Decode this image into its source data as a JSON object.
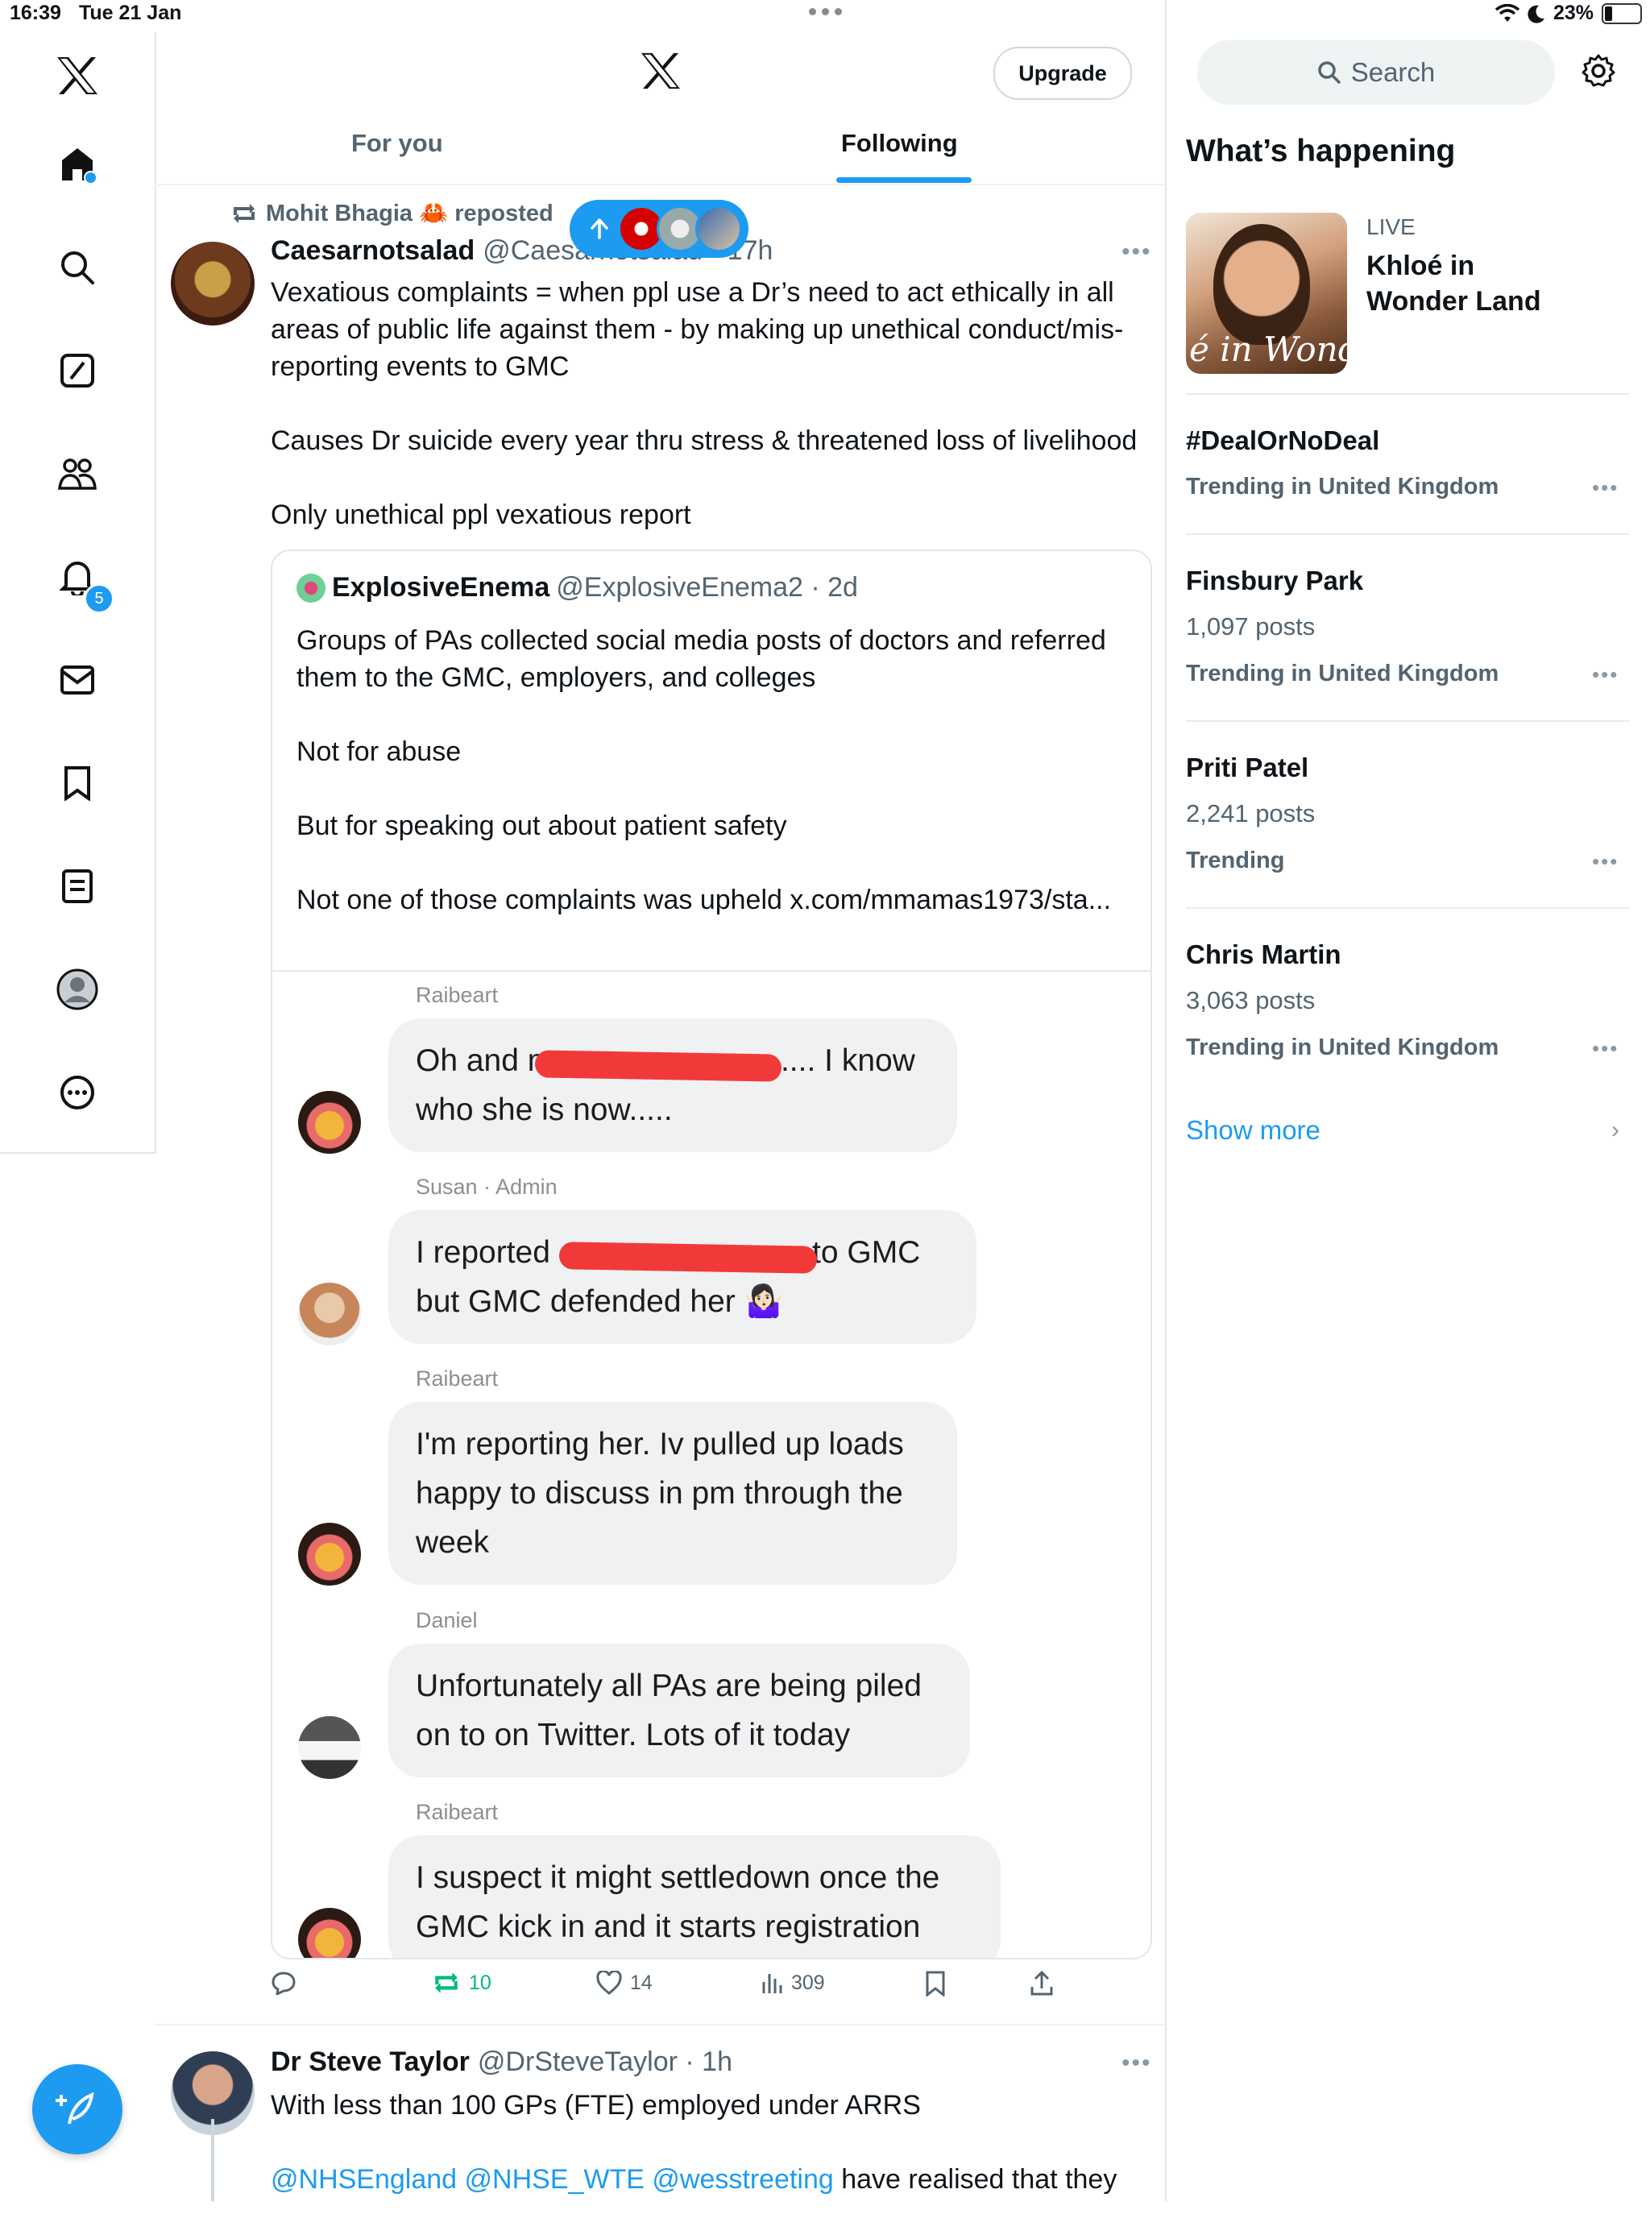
{
  "status_bar": {
    "time": "16:39",
    "date": "Tue 21 Jan",
    "battery": "23%"
  },
  "nav": {
    "notifications_badge": "5"
  },
  "header": {
    "upgrade_label": "Upgrade",
    "tabs": [
      "For you",
      "Following"
    ],
    "active_tab": "Following"
  },
  "tweet1": {
    "reposted_by": "Mohit Bhagia 🦀 reposted",
    "name": "Caesarnotsalad",
    "handle": "@Caesarnotsalad",
    "time": "· 17h",
    "paragraphs": [
      "Vexatious complaints = when ppl use a Dr’s need to act ethically in all areas of public life against them - by making up unethical conduct/mis-reporting events to GMC",
      "Causes Dr suicide every year thru stress & threatened loss of livelihood",
      "Only unethical ppl vexatious report"
    ],
    "quote": {
      "name": "ExplosiveEnema",
      "handle": "@ExplosiveEnema2 · 2d",
      "paragraphs": [
        "Groups of PAs collected social media posts of doctors and referred them to the GMC, employers, and colleges",
        "Not for abuse",
        "But for speaking out about patient safety",
        "Not one of those complaints was upheld x.com/mmamas1973/sta..."
      ]
    },
    "chat": [
      {
        "author": "Raibeart",
        "lines": [
          "Oh and m                          .... I know",
          "who she is now....."
        ]
      },
      {
        "author": "Susan · Admin",
        "lines": [
          "I reported                              to GMC",
          "but GMC defended her 🤷🏻‍♀️"
        ]
      },
      {
        "author": "Raibeart",
        "lines": [
          "I'm reporting her. Iv pulled up loads",
          "happy to discuss in pm through the",
          "week"
        ]
      },
      {
        "author": "Daniel",
        "lines": [
          "Unfortunately all PAs are being piled",
          "on to on Twitter. Lots of it today"
        ]
      },
      {
        "author": "Raibeart",
        "lines": [
          "I suspect it might settledown once the",
          "GMC kick in and it starts registration"
        ]
      }
    ],
    "actions": {
      "reposts": "10",
      "likes": "14",
      "views": "309"
    }
  },
  "tweet2": {
    "name": "Dr Steve Taylor",
    "handle": "@DrSteveTaylor · 1h",
    "line1": "With less than 100 GPs (FTE) employed under ARRS",
    "mentions": "@NHSEngland @NHSE_WTE @wesstreeting",
    "line2_rest": " have realised that they"
  },
  "sidebar": {
    "search_placeholder": "Search",
    "whats_happening": "What’s happening",
    "live": {
      "label": "LIVE",
      "title": "Khloé in Wonder Land",
      "image_text": "é in Wonder L"
    },
    "trends": [
      {
        "title": "#DealOrNoDeal",
        "count": "",
        "meta": "Trending in United Kingdom"
      },
      {
        "title": "Finsbury Park",
        "count": "1,097 posts",
        "meta": "Trending in United Kingdom"
      },
      {
        "title": "Priti Patel",
        "count": "2,241 posts",
        "meta": "Trending"
      },
      {
        "title": "Chris Martin",
        "count": "3,063 posts",
        "meta": "Trending in United Kingdom"
      }
    ],
    "show_more": "Show more"
  },
  "colors": {
    "accent": "#1d9bf0",
    "repost_green": "#00ba7c",
    "redaction": "#f2393a"
  }
}
